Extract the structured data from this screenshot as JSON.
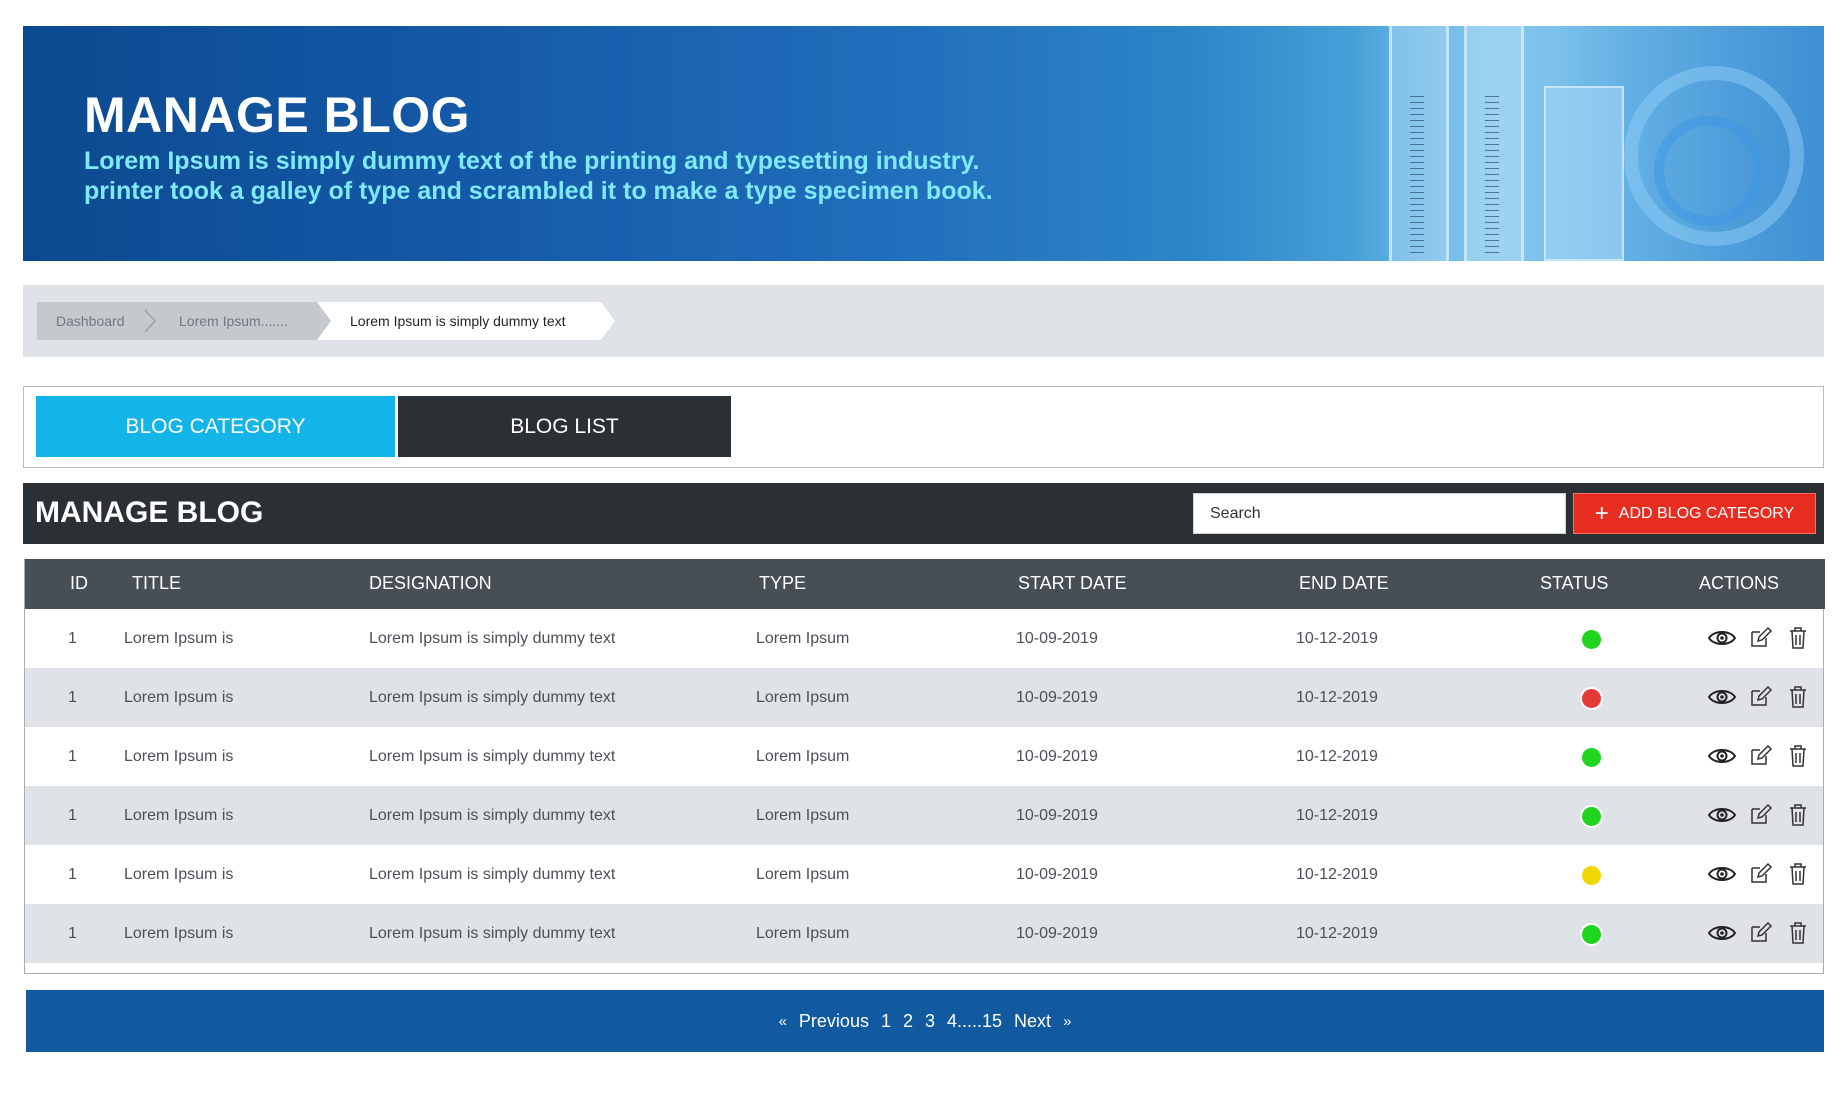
{
  "banner": {
    "title": "MANAGE BLOG",
    "subtitle": "Lorem Ipsum is simply dummy text of the printing and typesetting industry. printer took a galley of type and scrambled it to make a type specimen book."
  },
  "breadcrumb": {
    "items": [
      "Dashboard",
      "Lorem Ipsum.......",
      "Lorem Ipsum is simply dummy text"
    ]
  },
  "tabs": {
    "category": "BLOG CATEGORY",
    "list": "BLOG LIST",
    "active": "BLOG CATEGORY"
  },
  "toolbar": {
    "title": "MANAGE BLOG",
    "search_placeholder": "Search",
    "add_label": "ADD BLOG CATEGORY"
  },
  "table": {
    "headers": [
      "ID",
      "TITLE",
      "DESIGNATION",
      "TYPE",
      "START DATE",
      "END DATE",
      "STATUS",
      "ACTIONS"
    ],
    "rows": [
      {
        "id": "1",
        "title": "Lorem Ipsum is",
        "designation": "Lorem Ipsum is simply dummy text",
        "type": "Lorem Ipsum",
        "start": "10-09-2019",
        "end": "10-12-2019",
        "status": "green"
      },
      {
        "id": "1",
        "title": "Lorem Ipsum is",
        "designation": "Lorem Ipsum is simply dummy text",
        "type": "Lorem Ipsum",
        "start": "10-09-2019",
        "end": "10-12-2019",
        "status": "red"
      },
      {
        "id": "1",
        "title": "Lorem Ipsum is",
        "designation": "Lorem Ipsum is simply dummy text",
        "type": "Lorem Ipsum",
        "start": "10-09-2019",
        "end": "10-12-2019",
        "status": "green"
      },
      {
        "id": "1",
        "title": "Lorem Ipsum is",
        "designation": "Lorem Ipsum is simply dummy text",
        "type": "Lorem Ipsum",
        "start": "10-09-2019",
        "end": "10-12-2019",
        "status": "green"
      },
      {
        "id": "1",
        "title": "Lorem Ipsum is",
        "designation": "Lorem Ipsum is simply dummy text",
        "type": "Lorem Ipsum",
        "start": "10-09-2019",
        "end": "10-12-2019",
        "status": "yellow"
      },
      {
        "id": "1",
        "title": "Lorem Ipsum is",
        "designation": "Lorem Ipsum is simply dummy text",
        "type": "Lorem Ipsum",
        "start": "10-09-2019",
        "end": "10-12-2019",
        "status": "green"
      }
    ],
    "actions": [
      "eye-icon",
      "edit-icon",
      "trash-icon"
    ]
  },
  "status_colors": {
    "green": "#1fd51f",
    "red": "#e53935",
    "yellow": "#f2d600"
  },
  "pagination": {
    "prev_chevron": "«",
    "previous": "Previous",
    "pages": [
      "1",
      "2",
      "3",
      "4.....15"
    ],
    "next": "Next",
    "next_chevron": "»"
  },
  "colors": {
    "accent_tab": "#13b5e8",
    "dark": "#2b3035",
    "add_button": "#e72d1f",
    "pager": "#125aa0"
  }
}
